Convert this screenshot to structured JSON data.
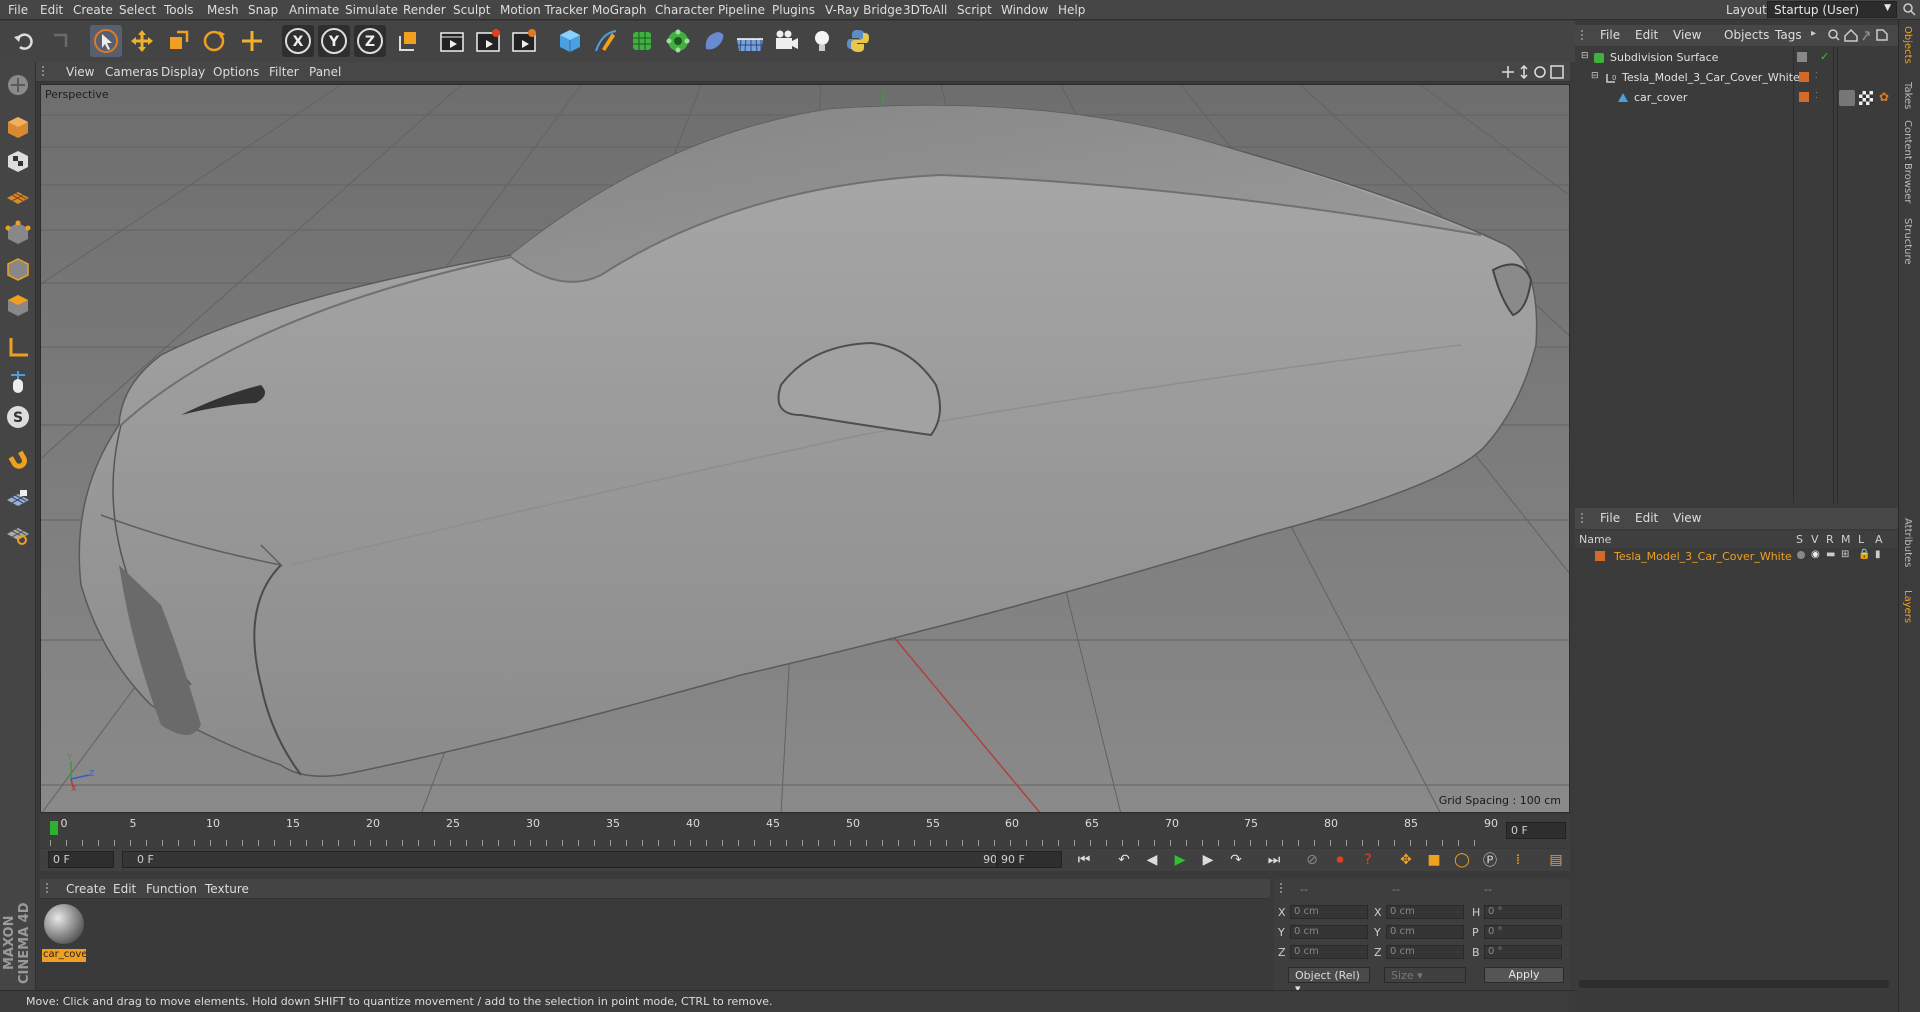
{
  "menubar": {
    "items": [
      "File",
      "Edit",
      "Create",
      "Select",
      "Tools",
      "Mesh",
      "Snap",
      "Animate",
      "Simulate",
      "Render",
      "Sculpt",
      "Motion Tracker",
      "MoGraph",
      "Character",
      "Pipeline",
      "Plugins",
      "V-Ray Bridge",
      "3DToAll",
      "Script",
      "Window",
      "Help"
    ],
    "layout_label": "Layout:",
    "layout_value": "Startup (User)"
  },
  "toolbar": {
    "icons": [
      "undo-icon",
      "redo-icon",
      "live-select-icon",
      "move-icon",
      "scale-icon",
      "rotate-icon",
      "recent-tool-icon",
      "x-axis-icon",
      "y-axis-icon",
      "z-axis-icon",
      "coordinate-system-icon",
      "render-view-icon",
      "render-picture-viewer-icon",
      "edit-render-settings-icon",
      "cube-icon",
      "pen-icon",
      "subdivision-icon",
      "array-icon",
      "deformer-icon",
      "floor-icon",
      "camera-icon",
      "light-icon",
      "python-icon"
    ],
    "axis_labels": [
      "X",
      "Y",
      "Z"
    ]
  },
  "left_tools": [
    "make-editable-icon",
    "model-mode-icon",
    "texture-mode-icon",
    "workplane-icon",
    "points-mode-icon",
    "edges-mode-icon",
    "polygons-mode-icon",
    "axis-icon",
    "tweak-icon",
    "soft-selection-icon",
    "snap-icon",
    "lock-workplane-icon",
    "planar-workplane-icon"
  ],
  "viewport": {
    "menu": [
      "View",
      "Cameras",
      "Display",
      "Options",
      "Filter",
      "Panel"
    ],
    "label": "Perspective",
    "grid_spacing": "Grid Spacing : 100 cm",
    "axis_letters": {
      "x": "X",
      "y": "Y",
      "z": "Z"
    }
  },
  "timeline": {
    "ticks": [
      "0",
      "5",
      "10",
      "15",
      "20",
      "25",
      "30",
      "35",
      "40",
      "45",
      "50",
      "55",
      "60",
      "65",
      "70",
      "75",
      "80",
      "85",
      "90"
    ],
    "current_frame": "0 F",
    "start_field": "0 F",
    "range_start": "0 F",
    "range_end": "90 F",
    "end_field": "90 F"
  },
  "material": {
    "menu": [
      "Create",
      "Edit",
      "Function",
      "Texture"
    ],
    "item_label": "car_cove"
  },
  "coords": {
    "headers": [
      "--",
      "--",
      "--"
    ],
    "rows": [
      {
        "a": "X",
        "av": "0 cm",
        "b": "X",
        "bv": "0 cm",
        "c": "H",
        "cv": "0 °"
      },
      {
        "a": "Y",
        "av": "0 cm",
        "b": "Y",
        "bv": "0 cm",
        "c": "P",
        "cv": "0 °"
      },
      {
        "a": "Z",
        "av": "0 cm",
        "b": "Z",
        "bv": "0 cm",
        "c": "B",
        "cv": "0 °"
      }
    ],
    "mode": "Object (Rel)",
    "size": "Size",
    "apply": "Apply"
  },
  "status": "Move: Click and drag to move elements. Hold down SHIFT to quantize movement / add to the selection in point mode, CTRL to remove.",
  "objects": {
    "menu": [
      "File",
      "Edit",
      "View",
      "Objects",
      "Tags"
    ],
    "tree": [
      "Subdivision Surface",
      "Tesla_Model_3_Car_Cover_White",
      "car_cover"
    ]
  },
  "layers": {
    "menu": [
      "File",
      "Edit",
      "View"
    ],
    "columns": [
      "Name",
      "S",
      "V",
      "R",
      "M",
      "L",
      "A"
    ],
    "items": [
      "Tesla_Model_3_Car_Cover_White"
    ]
  },
  "brand": "MAXON CINEMA 4D",
  "side_tabs": [
    "Objects",
    "Takes",
    "Content Browser",
    "Structure",
    "Attributes",
    "Layers"
  ],
  "colors": {
    "accent": "#e8a033",
    "selected_layer": "#f0a020",
    "layer_swatch": "#d46a2a"
  }
}
